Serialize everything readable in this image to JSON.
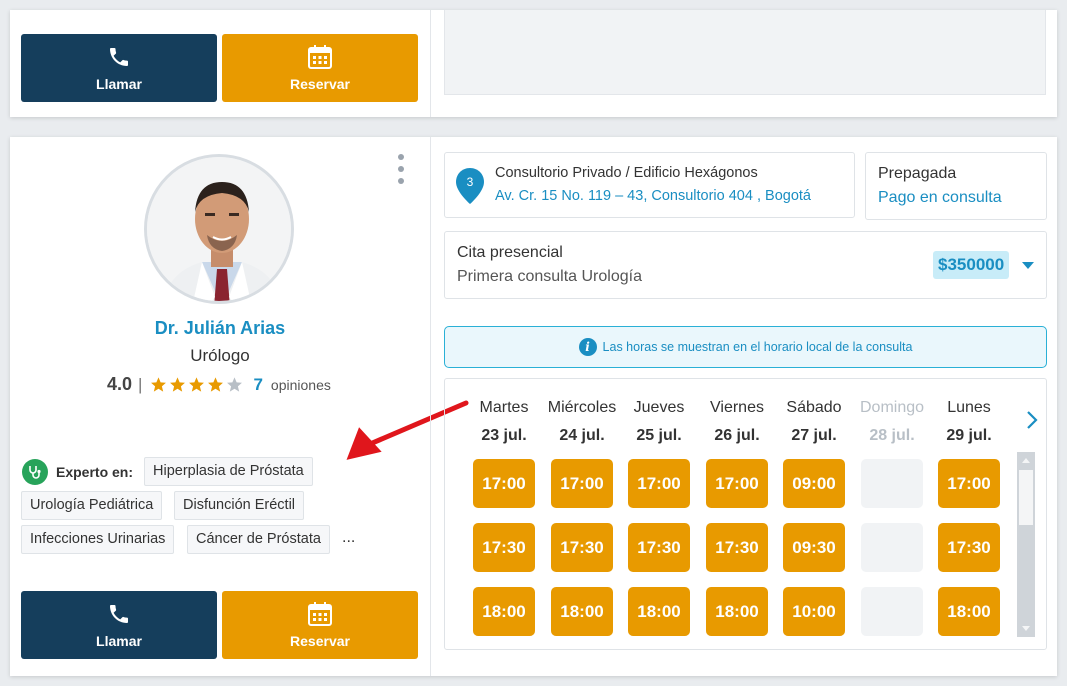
{
  "top_card": {
    "call_label": "Llamar",
    "book_label": "Reservar"
  },
  "doctor": {
    "name": "Dr. Julián Arias",
    "specialty": "Urólogo",
    "rating": "4.0",
    "rating_value": 4,
    "rating_max": 5,
    "separator": "|",
    "reviews_count": "7",
    "reviews_label": "opiniones",
    "expert_label": "Experto en:",
    "expertise": [
      "Hiperplasia de Próstata",
      "Urología Pediátrica",
      "Disfunción Eréctil",
      "Infecciones Urinarias",
      "Cáncer de Próstata"
    ],
    "more": "...",
    "call_label": "Llamar",
    "book_label": "Reservar"
  },
  "location": {
    "pin_number": "3",
    "title": "Consultorio Privado / Edificio Hexágonos",
    "address": "Av. Cr. 15 No. 119 – 43, Consultorio 404 , Bogotá"
  },
  "payment": {
    "title": "Prepagada",
    "subtitle": "Pago en consulta"
  },
  "visit": {
    "type": "Cita presencial",
    "reason": "Primera consulta Urología",
    "price": "$350000"
  },
  "info_banner": {
    "icon": "i",
    "text": "Las horas se muestran en el horario local de la consulta"
  },
  "calendar": {
    "days": [
      {
        "name": "Martes",
        "date": "23 jul.",
        "available": true,
        "slots": [
          "17:00",
          "17:30",
          "18:00"
        ]
      },
      {
        "name": "Miércoles",
        "date": "24 jul.",
        "available": true,
        "slots": [
          "17:00",
          "17:30",
          "18:00"
        ]
      },
      {
        "name": "Jueves",
        "date": "25 jul.",
        "available": true,
        "slots": [
          "17:00",
          "17:30",
          "18:00"
        ]
      },
      {
        "name": "Viernes",
        "date": "26 jul.",
        "available": true,
        "slots": [
          "17:00",
          "17:30",
          "18:00"
        ]
      },
      {
        "name": "Sábado",
        "date": "27 jul.",
        "available": true,
        "slots": [
          "09:00",
          "09:30",
          "10:00"
        ]
      },
      {
        "name": "Domingo",
        "date": "28 jul.",
        "available": false,
        "slots": [
          "",
          "",
          ""
        ]
      },
      {
        "name": "Lunes",
        "date": "29 jul.",
        "available": true,
        "slots": [
          "17:00",
          "17:30",
          "18:00"
        ]
      }
    ]
  },
  "colors": {
    "primary_dark": "#153e5c",
    "accent_orange": "#e89a00",
    "link_blue": "#1a8ec2",
    "annotation_red": "#e0161c",
    "expert_green": "#27a35a"
  }
}
